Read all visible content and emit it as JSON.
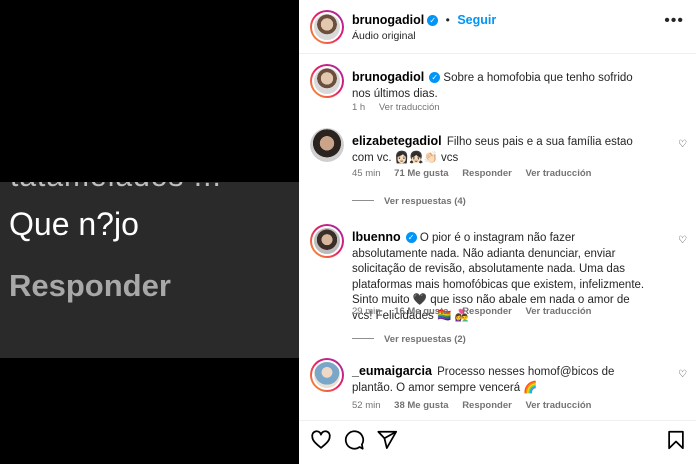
{
  "media": {
    "cut_text": "tatamelados ...",
    "big_text": "Que n?jo",
    "reply_text": "Responder"
  },
  "post": {
    "username": "brunogadiol",
    "follow_label": "Seguir",
    "audio": "Áudio original",
    "caption_username": "brunogadiol",
    "caption": "Sobre a homofobia que tenho sofrido nos últimos dias.",
    "caption_time": "1 h",
    "see_translation": "Ver traducción"
  },
  "comments": [
    {
      "username": "elizabetegadiol",
      "text": "Filho seus pais e a sua família estao com vc. 👩🏻‍👧🏻👏🏻 vcs",
      "time": "45 min",
      "likes": "71 Me gusta",
      "reply": "Responder",
      "translate": "Ver traducción",
      "view_replies": "Ver respuestas (4)"
    },
    {
      "username": "lbuenno",
      "text": "O pior é o instagram não fazer absolutamente nada. Não adianta denunciar, enviar solicitação de revisão, absolutamente nada. Uma das plataformas mais homofóbicas que existem, infelizmente. Sinto muito 🖤 que isso não abale em nada o amor de vcs! Felicidades 🏳️‍🌈 👩‍❤️‍👨",
      "time": "29 min",
      "likes": "16 Me gusta",
      "reply": "Responder",
      "translate": "Ver traducción",
      "view_replies": "Ver respuestas (2)"
    },
    {
      "username": "_eumaigarcia",
      "text": "Processo nesses homof@bicos de plantão. O amor sempre vencerá 🌈",
      "time": "52 min",
      "likes": "38 Me gusta",
      "reply": "Responder",
      "translate": "Ver traducción"
    }
  ],
  "icons": [
    "more-options-icon",
    "heart-icon",
    "comment-icon",
    "share-icon",
    "bookmark-icon",
    "verified-icon"
  ],
  "colors": {
    "link": "#0095f6",
    "muted": "#737373",
    "panel_bg": "#ffffff",
    "media_bg": "#000000"
  }
}
